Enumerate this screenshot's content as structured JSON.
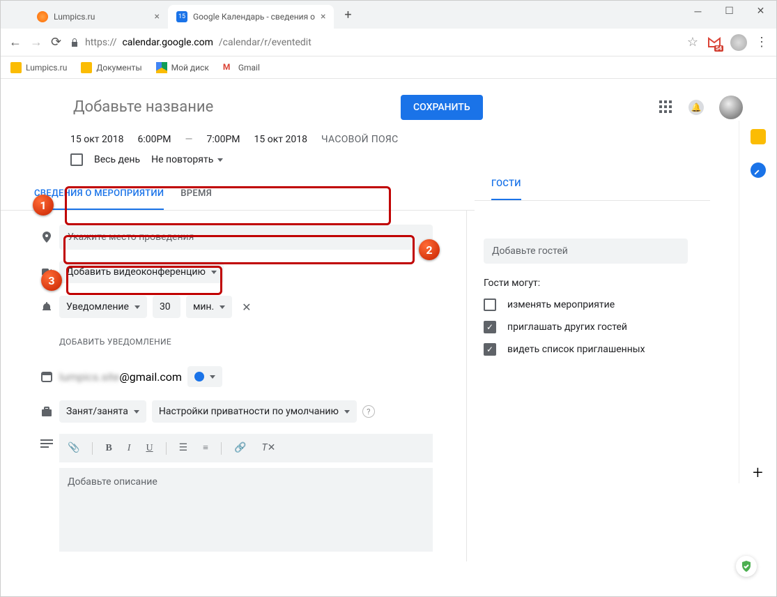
{
  "browser": {
    "tabs": [
      {
        "title": "Lumpics.ru"
      },
      {
        "title": "Google Календарь - сведения о"
      }
    ],
    "url_prefix": "https://",
    "url_domain": "calendar.google.com",
    "url_path": "/calendar/r/eventedit",
    "mail_badge": "54",
    "bookmarks": [
      "Lumpics.ru",
      "Документы",
      "Мой диск",
      "Gmail"
    ]
  },
  "annotations": {
    "badge1": "1",
    "badge2": "2",
    "badge3": "3"
  },
  "event": {
    "title_placeholder": "Добавьте название",
    "save_button": "СОХРАНИТЬ",
    "start_date": "15 окт 2018",
    "start_time": "6:00PM",
    "end_time": "7:00PM",
    "end_date": "15 окт 2018",
    "timezone": "ЧАСОВОЙ ПОЯС",
    "all_day_label": "Весь день",
    "repeat_label": "Не повторять"
  },
  "tabs": {
    "details": "СВЕДЕНИЯ О МЕРОПРИЯТИИ",
    "time": "ВРЕМЯ"
  },
  "details": {
    "location_placeholder": "Укажите место проведения",
    "video_conf": "Добавить видеоконференцию",
    "notification": "Уведомление",
    "notif_value": "30",
    "notif_unit": "мин.",
    "add_notification": "ДОБАВИТЬ УВЕДОМЛЕНИЕ",
    "calendar_email_blur": "lumpics.site",
    "calendar_email_suffix": "@gmail.com",
    "busy_status": "Занят/занята",
    "privacy": "Настройки приватности по умолчанию",
    "description_placeholder": "Добавьте описание"
  },
  "guests": {
    "tab": "ГОСТИ",
    "add_placeholder": "Добавьте гостей",
    "can_label": "Гости могут:",
    "perm_modify": "изменять мероприятие",
    "perm_invite": "приглашать других гостей",
    "perm_see": "видеть список приглашенных"
  }
}
